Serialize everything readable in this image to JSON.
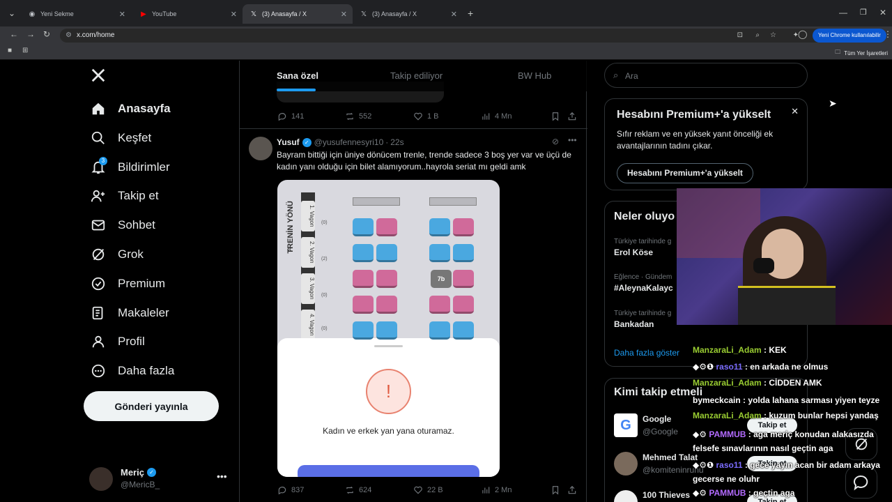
{
  "browser": {
    "tabs": [
      {
        "label": "Yeni Sekme",
        "icon": "chrome-icon"
      },
      {
        "label": "YouTube",
        "icon": "youtube-icon"
      },
      {
        "label": "(3) Anasayfa / X",
        "icon": "x-icon"
      },
      {
        "label": "(3) Anasayfa / X",
        "icon": "x-icon"
      }
    ],
    "url": "x.com/home",
    "profile_button": "Yeni Chrome kullanılabilir",
    "bookmarks_label": "Tüm Yer İşaretleri"
  },
  "sidebar": {
    "items": [
      {
        "label": "Anasayfa"
      },
      {
        "label": "Keşfet"
      },
      {
        "label": "Bildirimler",
        "badge": "3"
      },
      {
        "label": "Takip et"
      },
      {
        "label": "Sohbet"
      },
      {
        "label": "Grok"
      },
      {
        "label": "Premium"
      },
      {
        "label": "Makaleler"
      },
      {
        "label": "Profil"
      },
      {
        "label": "Daha fazla"
      }
    ],
    "post_button": "Gönderi yayınla",
    "account": {
      "name": "Meriç",
      "handle": "@MericB_"
    }
  },
  "feed": {
    "tabs": [
      "Sana özel",
      "Takip ediliyor",
      "BW Hub"
    ],
    "prev_post_actions": {
      "replies": "141",
      "reposts": "552",
      "likes": "1 B",
      "views": "4 Mn"
    },
    "post": {
      "name": "Yusuf",
      "handle": "@yusufennesyri10",
      "time": "22s",
      "text": "Bayram bittiği için üniye dönücem trenle, trende sadece 3 boş yer var ve üçü de kadın yanı olduğu için bilet alamıyorum..hayrola seriat mı geldi amk",
      "image": {
        "direction_label": "TRENİN YÖNÜ",
        "wagons": [
          {
            "label": "1. Vagon",
            "count": "(0)"
          },
          {
            "label": "2. Vagon",
            "count": "(2)"
          },
          {
            "label": "3. Vagon",
            "count": "(0)"
          },
          {
            "label": "4. Vagon",
            "count": "(0)"
          }
        ],
        "seat_label": "7b",
        "dialog_text": "Kadın ve erkek yan yana oturamaz."
      },
      "actions": {
        "replies": "837",
        "reposts": "624",
        "likes": "22 B",
        "views": "2 Mn"
      }
    }
  },
  "right": {
    "search_placeholder": "Ara",
    "premium": {
      "title": "Hesabını Premium+'a yükselt",
      "body": "Sıfır reklam ve en yüksek yanıt önceliği ek avantajlarının tadını çıkar.",
      "button": "Hesabını Premium+'a yükselt"
    },
    "trends": {
      "title": "Neler oluyo",
      "items": [
        {
          "context": "Türkiye tarihinde g",
          "name": "Erol Köse"
        },
        {
          "context": "Eğlence · Gündem",
          "name": "#AleynaKalayc"
        },
        {
          "context": "Türkiye tarihinde g",
          "name": "Bankadan"
        }
      ],
      "more": "Daha fazla göster"
    },
    "who_to_follow": {
      "title": "Kimi takip etmeli",
      "items": [
        {
          "name": "Google",
          "handle": "@Google",
          "button": "Takip et"
        },
        {
          "name": "Mehmed Talat",
          "handle": "@komiteninrunu",
          "button": "Takip et"
        },
        {
          "name": "100 Thieves",
          "handle": "",
          "button": "Takip et"
        }
      ]
    }
  },
  "stream_chat": [
    {
      "user": "ManzaraLi_Adam",
      "msg": "KEK",
      "color": "#9acd32"
    },
    {
      "user": "raso11",
      "msg": "en arkada ne olmus",
      "color": "#7b6cff"
    },
    {
      "user": "ManzaraLi_Adam",
      "msg": "CİDDEN AMK",
      "color": "#9acd32"
    },
    {
      "user": "bymeckcain",
      "msg": "yolda lahana sarması yiyen teyze",
      "color": "#ffffff"
    },
    {
      "user": "ManzaraLi_Adam",
      "msg": "kuzum bunlar hepsi yandaş",
      "color": "#9acd32"
    },
    {
      "user": "PAMMUB",
      "msg": "aga meriç konudan alakasızda felsefe sınavlarının nasıl geçtin aga",
      "color": "#b36bff"
    },
    {
      "user": "raso11",
      "msg": "gece yayın acan bir adam arkaya gecerse ne oluhr",
      "color": "#7b6cff"
    },
    {
      "user": "PAMMUB",
      "msg": "geçtin aga",
      "color": "#b36bff"
    }
  ],
  "colors": {
    "accent": "#1d9bf0",
    "bg": "#000000",
    "border": "#2f3336"
  }
}
